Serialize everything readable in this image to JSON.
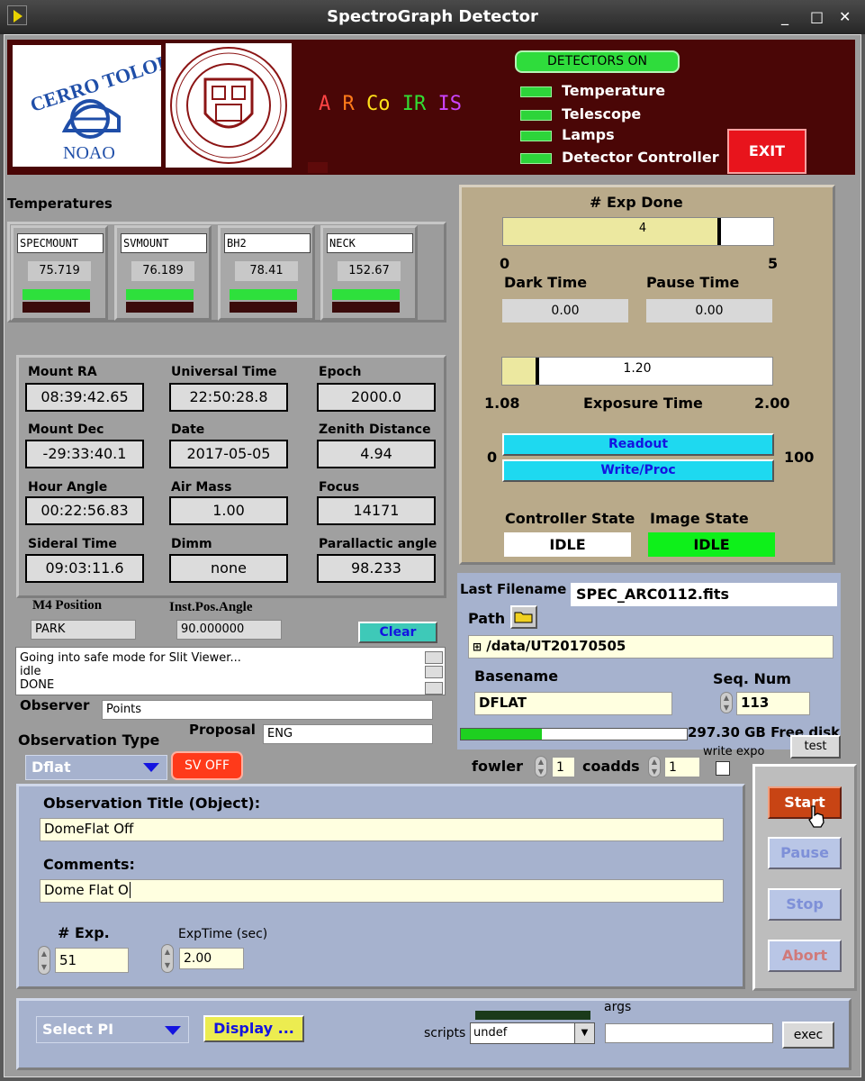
{
  "window": {
    "title": "SpectroGraph Detector",
    "minimize": "_",
    "maximize": "□",
    "close": "✕"
  },
  "header": {
    "instrument_letters": [
      {
        "text": "A",
        "color": "#ff4444"
      },
      {
        "text": "R",
        "color": "#ff7a1a"
      },
      {
        "text": "Co",
        "color": "#ffe11a"
      },
      {
        "text": "IR",
        "color": "#33dd33"
      },
      {
        "text": "IS",
        "color": "#cc44ff"
      }
    ],
    "detectors_on": "DETECTORS ON",
    "status_lights": [
      "Temperature",
      "Telescope",
      "Lamps",
      "Detector Controller"
    ],
    "exit_label": "EXIT",
    "logo1_text": "CERRO TOLOLO",
    "logo1_sub": "NOAO"
  },
  "temperatures": {
    "title": "Temperatures",
    "sensors": [
      {
        "name": "SPECMOUNT",
        "value": "75.719"
      },
      {
        "name": "SVMOUNT",
        "value": "76.189"
      },
      {
        "name": "BH2",
        "value": "78.41"
      },
      {
        "name": "NECK",
        "value": "152.67"
      }
    ]
  },
  "telescope": {
    "fields": [
      {
        "label": "Mount RA",
        "value": "08:39:42.65"
      },
      {
        "label": "Universal Time",
        "value": "22:50:28.8"
      },
      {
        "label": "Epoch",
        "value": "2000.0"
      },
      {
        "label": "Mount Dec",
        "value": "-29:33:40.1"
      },
      {
        "label": "Date",
        "value": "2017-05-05"
      },
      {
        "label": "Zenith Distance",
        "value": "4.94"
      },
      {
        "label": "Hour Angle",
        "value": "00:22:56.83"
      },
      {
        "label": "Air Mass",
        "value": "1.00"
      },
      {
        "label": "Focus",
        "value": "14171"
      },
      {
        "label": "Sideral Time",
        "value": "09:03:11.6"
      },
      {
        "label": "Dimm",
        "value": "none"
      },
      {
        "label": "Parallactic angle",
        "value": "98.233"
      }
    ],
    "m4_label": "M4 Position",
    "m4_value": "PARK",
    "inst_label": "Inst.Pos.Angle",
    "inst_value": "90.000000",
    "clear_label": "Clear"
  },
  "log": {
    "lines": [
      "Going into safe mode for Slit Viewer...",
      "idle",
      "DONE"
    ]
  },
  "observer": {
    "label": "Observer",
    "value": "Points"
  },
  "proposal": {
    "label": "Proposal",
    "value": "ENG"
  },
  "observation_type": {
    "label": "Observation Type",
    "value": "Dflat",
    "sv_label": "SV OFF"
  },
  "exposure": {
    "exp_done_label": "# Exp Done",
    "exp_done_value": "4",
    "exp_done_fraction": 0.8,
    "exp_done_min": "0",
    "exp_done_max": "5",
    "dark_label": "Dark Time",
    "dark_value": "0.00",
    "pause_label": "Pause Time",
    "pause_value": "0.00",
    "exptime_value": "1.20",
    "exptime_fraction": 0.13,
    "exptime_min": "1.08",
    "exptime_max": "2.00",
    "exptime_label": "Exposure Time",
    "readout_min": "0",
    "readout_max": "100",
    "readout_label": "Readout",
    "writeproc_label": "Write/Proc",
    "controller_state_label": "Controller State",
    "controller_state": "IDLE",
    "image_state_label": "Image State",
    "image_state": "IDLE"
  },
  "files": {
    "last_filename_label": "Last Filename",
    "last_filename": "SPEC_ARC0112.fits",
    "path_label": "Path",
    "path_value": "/data/UT20170505",
    "basename_label": "Basename",
    "basename_value": "DFLAT",
    "seqnum_label": "Seq. Num",
    "seqnum_value": "113",
    "disk_text": "297.30 GB Free disk",
    "disk_fraction": 0.36,
    "write_expo_label": "write expo",
    "test_label": "test",
    "fowler_label": "fowler",
    "fowler_value": "1",
    "coadds_label": "coadds",
    "coadds_value": "1"
  },
  "observation": {
    "title_label": "Observation Title (Object):",
    "title_value": "DomeFlat Off",
    "comments_label": "Comments:",
    "comments_value": "Dome Flat O",
    "nexp_label": "# Exp.",
    "nexp_value": "51",
    "exptime_label": "ExpTime (sec)",
    "exptime_value": "2.00"
  },
  "controls": {
    "start": "Start",
    "pause": "Pause",
    "stop": "Stop",
    "abort": "Abort"
  },
  "bottom": {
    "select_pi": "Select PI",
    "display": "Display ...",
    "scripts_label": "scripts",
    "scripts_value": "undef",
    "args_label": "args",
    "exec_label": "exec"
  }
}
